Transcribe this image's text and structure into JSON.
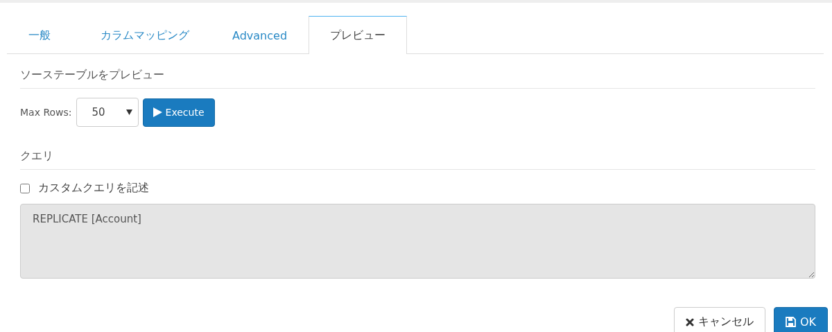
{
  "tabs": [
    {
      "label": "一般",
      "selected": false
    },
    {
      "label": "カラムマッピング",
      "selected": false
    },
    {
      "label": "Advanced",
      "selected": false
    },
    {
      "label": "プレビュー",
      "selected": true
    }
  ],
  "preview_section": {
    "heading": "ソーステーブルをプレビュー",
    "max_rows_label": "Max Rows:",
    "max_rows_value": "50",
    "execute_button": "Execute"
  },
  "query_section": {
    "heading": "クエリ",
    "custom_query": {
      "label": "カスタムクエリを記述",
      "checked": false
    },
    "query_text": "REPLICATE [Account]",
    "query_disabled": true
  },
  "buttons": [
    {
      "kind": "cancel",
      "label": "キャンセル"
    },
    {
      "kind": "ok",
      "label": "OK"
    }
  ]
}
